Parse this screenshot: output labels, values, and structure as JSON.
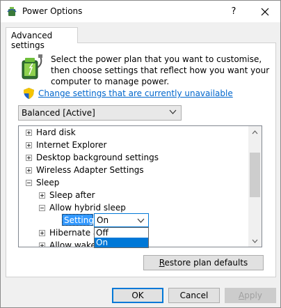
{
  "window": {
    "title": "Power Options",
    "help_label": "?",
    "close_label": "✕"
  },
  "tab": {
    "label": "Advanced settings"
  },
  "description": "Select the power plan that you want to customise, then choose settings that reflect how you want your computer to manage power.",
  "change_link": "Change settings that are currently unavailable",
  "plan_select": {
    "value": "Balanced [Active]"
  },
  "tree": {
    "items": [
      {
        "label": "Hard disk",
        "toggle": "plus",
        "level": 0
      },
      {
        "label": "Internet Explorer",
        "toggle": "plus",
        "level": 0
      },
      {
        "label": "Desktop background settings",
        "toggle": "plus",
        "level": 0
      },
      {
        "label": "Wireless Adapter Settings",
        "toggle": "plus",
        "level": 0
      },
      {
        "label": "Sleep",
        "toggle": "minus",
        "level": 0
      },
      {
        "label": "Sleep after",
        "toggle": "plus",
        "level": 1
      },
      {
        "label": "Allow hybrid sleep",
        "toggle": "minus",
        "level": 1
      },
      {
        "label": "Hibernate af",
        "toggle": "plus",
        "level": 1
      },
      {
        "label": "Allow wake t",
        "toggle": "plus",
        "level": 1
      }
    ],
    "setting_label": "Setting:",
    "setting_value": "On",
    "dropdown_options": [
      "Off",
      "On"
    ],
    "dropdown_selected": "On"
  },
  "buttons": {
    "restore_prefix": "R",
    "restore_rest": "estore plan defaults",
    "ok": "OK",
    "cancel": "Cancel",
    "apply_prefix": "A",
    "apply_rest": "pply"
  },
  "colors": {
    "link": "#0066cc",
    "selection": "#0078d7",
    "setting_highlight": "#3399ff"
  }
}
